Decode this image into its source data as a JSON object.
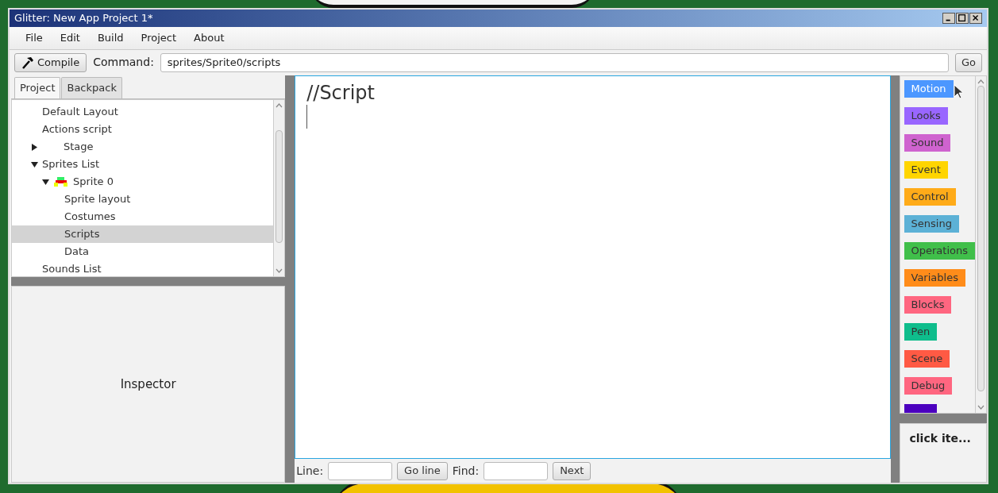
{
  "window": {
    "title": "Glitter: New App Project 1*"
  },
  "menu": [
    "File",
    "Edit",
    "Build",
    "Project",
    "About"
  ],
  "toolbar": {
    "compile": "Compile",
    "command_label": "Command:",
    "command_value": "sprites/Sprite0/scripts",
    "go": "Go"
  },
  "left_tabs": [
    {
      "label": "Project",
      "selected": true
    },
    {
      "label": "Backpack",
      "selected": false
    }
  ],
  "tree": [
    {
      "label": "Default Layout",
      "selected": false
    },
    {
      "label": "Actions script",
      "selected": false
    },
    {
      "label": "Stage",
      "expanded": false,
      "selected": false
    },
    {
      "label": "Sprites List",
      "expanded": true,
      "selected": false,
      "children": [
        {
          "label": "Sprite 0",
          "expanded": true,
          "selected": false,
          "kind": "sprite",
          "children": [
            {
              "label": "Sprite layout",
              "selected": false
            },
            {
              "label": "Costumes",
              "selected": false
            },
            {
              "label": "Scripts",
              "selected": true
            },
            {
              "label": "Data",
              "selected": false
            }
          ]
        }
      ]
    },
    {
      "label": "Sounds List",
      "selected": false
    }
  ],
  "inspector": {
    "title": "Inspector"
  },
  "editor": {
    "text": "//Script"
  },
  "editor_bar": {
    "line_label": "Line:",
    "go_line": "Go line",
    "find_label": "Find:",
    "next": "Next"
  },
  "categories": [
    {
      "label": "Motion",
      "color": "#4c97ff"
    },
    {
      "label": "Looks",
      "color": "#9966ff"
    },
    {
      "label": "Sound",
      "color": "#cf63cf"
    },
    {
      "label": "Event",
      "color": "#ffd500"
    },
    {
      "label": "Control",
      "color": "#ffab19"
    },
    {
      "label": "Sensing",
      "color": "#5cb1d6"
    },
    {
      "label": "Operations",
      "color": "#40bf4a"
    },
    {
      "label": "Variables",
      "color": "#ff8c1a"
    },
    {
      "label": "Blocks",
      "color": "#ff6680"
    },
    {
      "label": "Pen",
      "color": "#0fbd8c"
    },
    {
      "label": "Scene",
      "color": "#ff5a44"
    },
    {
      "label": "Debug",
      "color": "#ff6680"
    },
    {
      "color": "#4c00bf"
    }
  ],
  "help": {
    "text": "click ite..."
  }
}
